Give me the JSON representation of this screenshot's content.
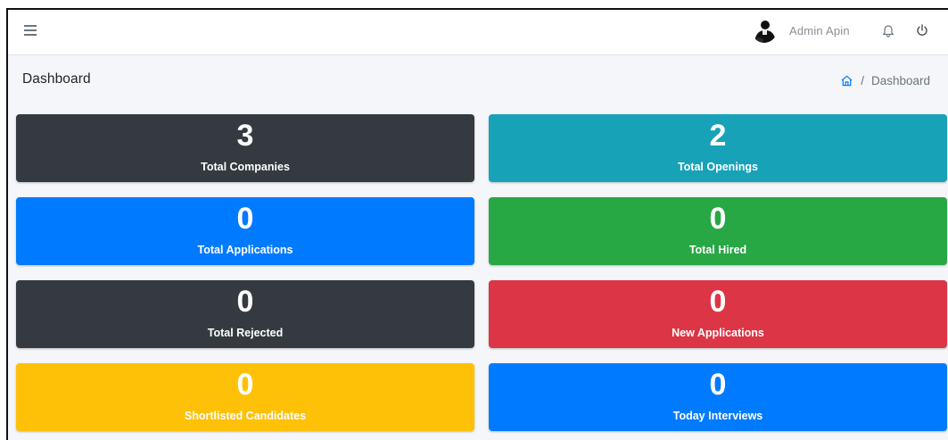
{
  "topbar": {
    "admin_name": "Admin Apin",
    "icons": {
      "menu": "hamburger-menu-icon",
      "avatar": "user-avatar",
      "notifications": "bell-icon",
      "logout": "power-icon"
    }
  },
  "page": {
    "title": "Dashboard",
    "breadcrumb": {
      "separator": "/",
      "current": "Dashboard"
    }
  },
  "cards": [
    {
      "count": "3",
      "label": "Total Companies",
      "color": "#343a40"
    },
    {
      "count": "2",
      "label": "Total Openings",
      "color": "#17a2b8"
    },
    {
      "count": "0",
      "label": "Total Applications",
      "color": "#007bff"
    },
    {
      "count": "0",
      "label": "Total Hired",
      "color": "#28a745"
    },
    {
      "count": "0",
      "label": "Total Rejected",
      "color": "#343a40"
    },
    {
      "count": "0",
      "label": "New Applications",
      "color": "#dc3545"
    },
    {
      "count": "0",
      "label": "Shortlisted Candidates",
      "color": "#ffc107"
    },
    {
      "count": "0",
      "label": "Today Interviews",
      "color": "#007bff"
    }
  ],
  "colors": {
    "link": "#007bff",
    "muted": "#6c757d",
    "background": "#f4f6f9"
  }
}
